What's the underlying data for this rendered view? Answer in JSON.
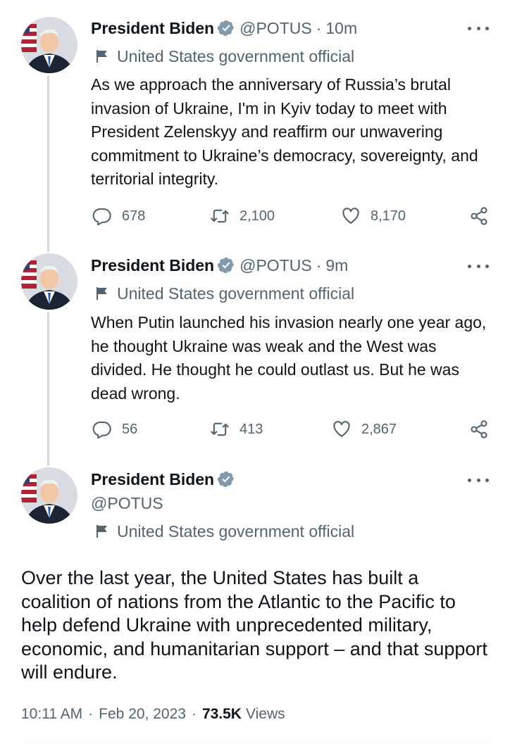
{
  "tweets": [
    {
      "name": "President Biden",
      "handle": "@POTUS",
      "time_sep": "·",
      "time": "10m",
      "label": "United States government official",
      "text": "As we approach the anniversary of Russia’s brutal invasion of Ukraine, I'm in Kyiv today to meet with President Zelenskyy and reaffirm our unwavering commitment to Ukraine’s democracy, sovereignty, and territorial integrity.",
      "replies": "678",
      "retweets": "2,100",
      "likes": "8,170"
    },
    {
      "name": "President Biden",
      "handle": "@POTUS",
      "time_sep": "·",
      "time": "9m",
      "label": "United States government official",
      "text": "When Putin launched his invasion nearly one year ago, he thought Ukraine was weak and the West was divided.  He thought he could outlast us. But he was dead wrong.",
      "replies": "56",
      "retweets": "413",
      "likes": "2,867"
    }
  ],
  "main_tweet": {
    "name": "President Biden",
    "handle": "@POTUS",
    "label": "United States government official",
    "text": "Over the last year, the United States has built a coalition of nations from the Atlantic to the Pacific to help defend Ukraine with unprecedented military, economic, and humanitarian support – and that support will endure.",
    "time": "10:11 AM",
    "sep": "·",
    "date": "Feb 20, 2023",
    "views_count": "73.5K",
    "views_label": "Views"
  },
  "icons": {
    "verified": "verified-badge-icon",
    "label": "flag-icon",
    "reply": "reply-icon",
    "retweet": "retweet-icon",
    "like": "heart-icon",
    "share": "share-icon",
    "more": "more-options-icon"
  },
  "colors": {
    "text": "#0f1419",
    "secondary": "#536471",
    "verified": "#829aab",
    "thread_line": "#cfd9de"
  }
}
